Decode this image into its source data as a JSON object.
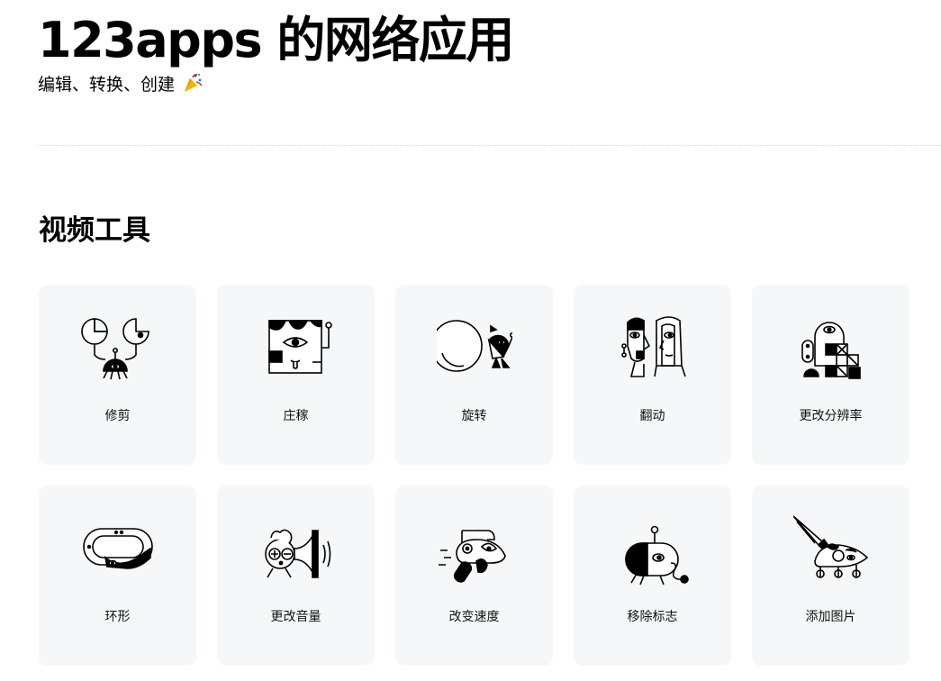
{
  "header": {
    "title": "123apps 的网络应用",
    "subtitle": "编辑、转换、创建"
  },
  "section": {
    "title": "视频工具"
  },
  "tools": [
    {
      "label": "修剪",
      "icon": "crab-scissors-icon"
    },
    {
      "label": "庄稼",
      "icon": "square-face-crop-icon"
    },
    {
      "label": "旋转",
      "icon": "rolling-ball-creature-icon"
    },
    {
      "label": "翻动",
      "icon": "mirrored-faces-flip-icon"
    },
    {
      "label": "更改分辨率",
      "icon": "pixel-robot-resolution-icon"
    },
    {
      "label": "环形",
      "icon": "ring-snake-loop-icon"
    },
    {
      "label": "更改音量",
      "icon": "horn-volume-icon"
    },
    {
      "label": "改变速度",
      "icon": "speedy-creature-icon"
    },
    {
      "label": "移除标志",
      "icon": "pill-bug-logo-remover-icon"
    },
    {
      "label": "添加图片",
      "icon": "brush-mouse-image-icon"
    }
  ],
  "colors": {
    "card_background": "#f6f7f9",
    "text": "#000000",
    "divider": "#d8d8d8"
  }
}
